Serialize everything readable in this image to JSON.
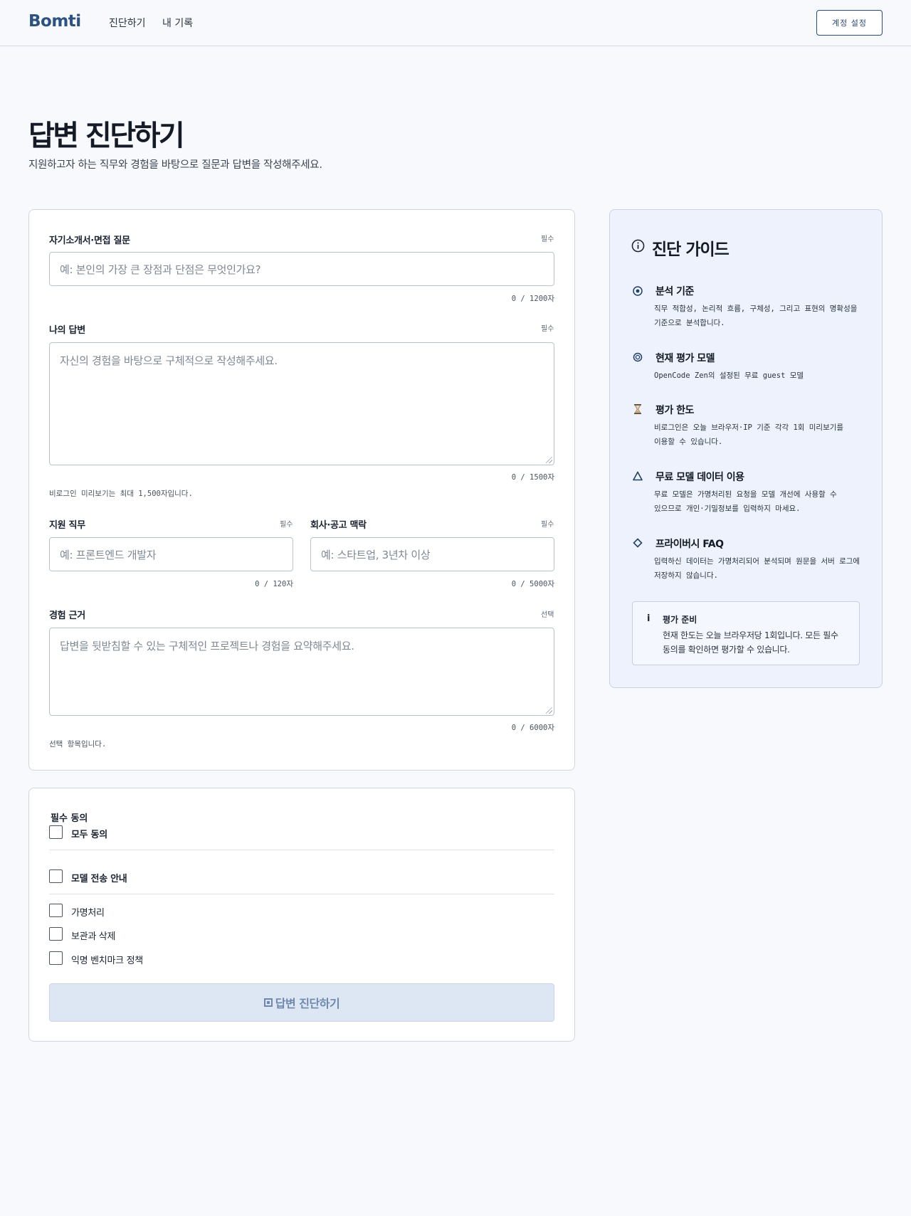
{
  "header": {
    "logo": "Bomti",
    "nav": [
      "진단하기",
      "내 기록"
    ],
    "account_button": "계정 설정"
  },
  "page": {
    "title": "답변 진단하기",
    "subtitle": "지원하고자 하는 직무와 경험을 바탕으로 질문과 답변을 작성해주세요."
  },
  "form": {
    "question": {
      "label": "자기소개서·면접 질문",
      "tag": "필수",
      "placeholder": "예: 본인의 가장 큰 장점과 단점은 무엇인가요?",
      "counter": "0 / 1200자"
    },
    "answer": {
      "label": "나의 답변",
      "tag": "필수",
      "placeholder": "자신의 경험을 바탕으로 구체적으로 작성해주세요.",
      "counter": "0 / 1500자",
      "helper": "비로그인 미리보기는 최대 1,500자입니다."
    },
    "role": {
      "label": "지원 직무",
      "tag": "필수",
      "placeholder": "예: 프론트엔드 개발자",
      "counter": "0 / 120자"
    },
    "company": {
      "label": "회사·공고 맥락",
      "tag": "필수",
      "placeholder": "예: 스타트업, 3년차 이상",
      "counter": "0 / 5000자"
    },
    "evidence": {
      "label": "경험 근거",
      "tag": "선택",
      "placeholder": "답변을 뒷받침할 수 있는 구체적인 프로젝트나 경험을 요약해주세요.",
      "counter": "0 / 6000자",
      "helper": "선택 항목입니다."
    }
  },
  "consent": {
    "title": "필수 동의",
    "all": "모두 동의",
    "model_transfer": "모델 전송 안내",
    "items": [
      "가명처리",
      "보관과 삭제",
      "익명 벤치마크 정책"
    ],
    "submit": "답변 진단하기"
  },
  "guide": {
    "title": "진단 가이드",
    "items": [
      {
        "icon": "target-icon",
        "title": "분석 기준",
        "desc": "직무 적합성, 논리적 흐름, 구체성, 그리고 표현의 명확성을 기준으로 분석합니다."
      },
      {
        "icon": "model-icon",
        "title": "현재 평가 모델",
        "desc": "OpenCode Zen의 설정된 무료 guest 모델"
      },
      {
        "icon": "hourglass-icon",
        "title": "평가 한도",
        "desc": "비로그인은 오늘 브라우저·IP 기준 각각 1회 미리보기를 이용할 수 있습니다."
      },
      {
        "icon": "warning-icon",
        "title": "무료 모델 데이터 이용",
        "desc": "무료 모델은 가명처리된 요청을 모델 개선에 사용할 수 있으므로 개인·기밀정보를 입력하지 마세요."
      },
      {
        "icon": "diamond-icon",
        "title": "프라이버시 FAQ",
        "desc": "입력하신 데이터는 가명처리되어 분석되며 원문을 서버 로그에 저장하지 않습니다."
      }
    ],
    "notice": {
      "icon": "i",
      "title": "평가 준비",
      "text": "현재 한도는 오늘 브라우저당 1회입니다. 모든 필수 동의를 확인하면 평가할 수 있습니다."
    }
  }
}
